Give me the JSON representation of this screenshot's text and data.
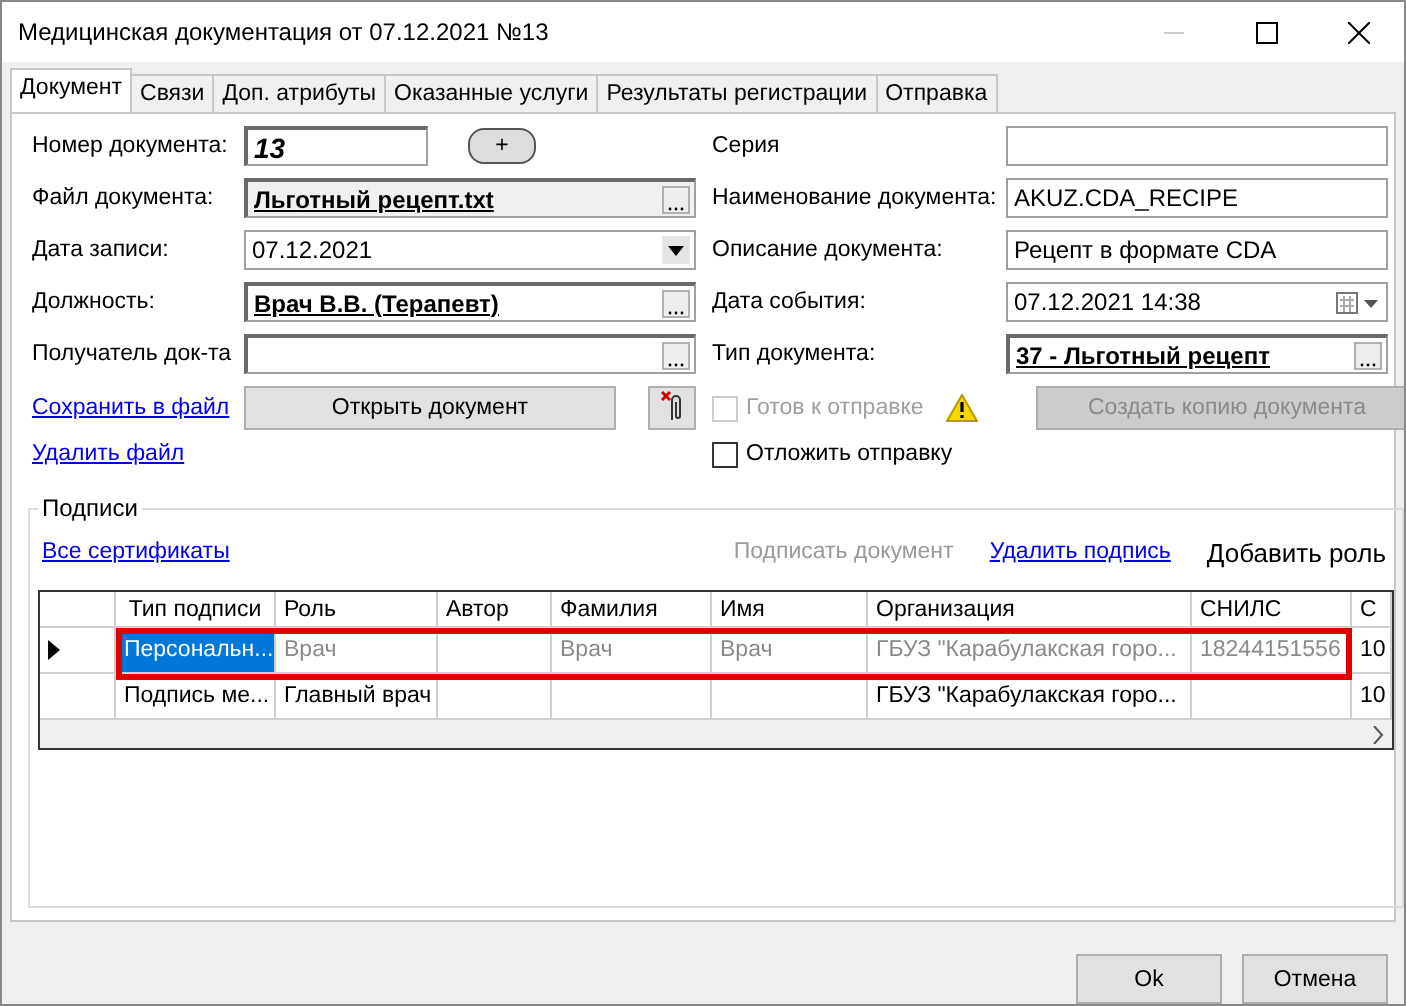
{
  "window": {
    "title": "Медицинская документация от 07.12.2021 №13"
  },
  "tabs": [
    {
      "label": "Документ",
      "selected": true
    },
    {
      "label": "Связи",
      "selected": false
    },
    {
      "label": "Доп. атрибуты",
      "selected": false
    },
    {
      "label": "Оказанные услуги",
      "selected": false
    },
    {
      "label": "Результаты регистрации",
      "selected": false
    },
    {
      "label": "Отправка",
      "selected": false
    }
  ],
  "left_fields": [
    {
      "label": "Номер документа:",
      "kind": "number",
      "value": "13",
      "button": "+"
    },
    {
      "label": "Файл документа:",
      "kind": "file",
      "value": "Льготный рецепт.txt"
    },
    {
      "label": "Дата записи:",
      "kind": "date",
      "value": "07.12.2021"
    },
    {
      "label": "Должность:",
      "kind": "lookup",
      "value": "Врач В.В. (Терапевт)"
    },
    {
      "label": "Получатель док-та",
      "kind": "lookup"
    }
  ],
  "right_fields": [
    {
      "label": "Серия",
      "kind": "text"
    },
    {
      "label": "Наименование документа:",
      "kind": "text",
      "value": "AKUZ.CDA_RECIPE"
    },
    {
      "label": "Описание документа:",
      "kind": "text",
      "value": "Рецепт в формате CDA"
    },
    {
      "label": "Дата события:",
      "kind": "datetime",
      "value": "07.12.2021 14:38"
    },
    {
      "label": "Тип документа:",
      "kind": "lookup",
      "value": "37 - Льготный рецепт"
    }
  ],
  "links": [
    "Сохранить в файл",
    "Удалить файл"
  ],
  "open_button": "Открыть документ",
  "ready_checkbox": {
    "label": "Готов к отправке",
    "checked": false,
    "disabled": true
  },
  "copy_button": {
    "label": "Создать копию документа",
    "disabled": true
  },
  "postpone_checkbox": {
    "label": "Отложить отправку",
    "checked": false,
    "disabled": false
  },
  "signatures": {
    "title": "Подписи",
    "all_certs_link": "Все сертификаты",
    "actions": [
      {
        "label": "Подписать документ",
        "kind": "disabled"
      },
      {
        "label": "Удалить подпись",
        "kind": "link"
      },
      {
        "label": "Добавить роль",
        "kind": "button"
      }
    ],
    "columns": [
      "Тип подписи",
      "Роль",
      "Автор",
      "Фамилия",
      "Имя",
      "Организация",
      "СНИЛС",
      "С"
    ],
    "rows": [
      {
        "selected": true,
        "highlighted": true,
        "cells": [
          "Персональн...",
          "Врач",
          "",
          "Врач",
          "Врач",
          "ГБУЗ \"Карабулакская горо...",
          "18244151556",
          "10"
        ]
      },
      {
        "selected": false,
        "highlighted": false,
        "cells": [
          "Подпись ме...",
          "Главный врач",
          "",
          "",
          "",
          "ГБУЗ \"Карабулакская горо...",
          "",
          "10"
        ]
      }
    ]
  },
  "buttons": [
    "Ok",
    "Отмена"
  ]
}
